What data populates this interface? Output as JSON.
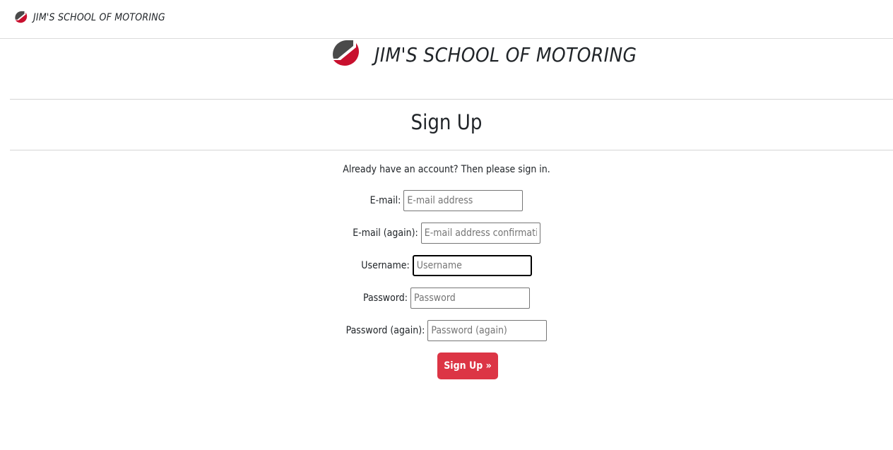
{
  "navbar": {
    "brand": "JIM'S SCHOOL OF MOTORING",
    "logo_icon": "jsm-logo-icon"
  },
  "hero": {
    "brand": "JIM'S SCHOOL OF MOTORING",
    "logo_icon": "jsm-logo-icon"
  },
  "page_title": "Sign Up",
  "lead": "Already have an account? Then please sign in.",
  "form": {
    "email": {
      "label": "E-mail:",
      "placeholder": "E-mail address",
      "value": ""
    },
    "email2": {
      "label": "E-mail (again):",
      "placeholder": "E-mail address confirmation",
      "value": ""
    },
    "username": {
      "label": "Username:",
      "placeholder": "Username",
      "value": ""
    },
    "password": {
      "label": "Password:",
      "placeholder": "Password",
      "value": ""
    },
    "password2": {
      "label": "Password (again):",
      "placeholder": "Password (again)",
      "value": ""
    },
    "submit_label": "Sign Up »"
  },
  "colors": {
    "accent": "#dc3545",
    "logo_red": "#c8102e",
    "logo_gray": "#4a4a4a"
  }
}
